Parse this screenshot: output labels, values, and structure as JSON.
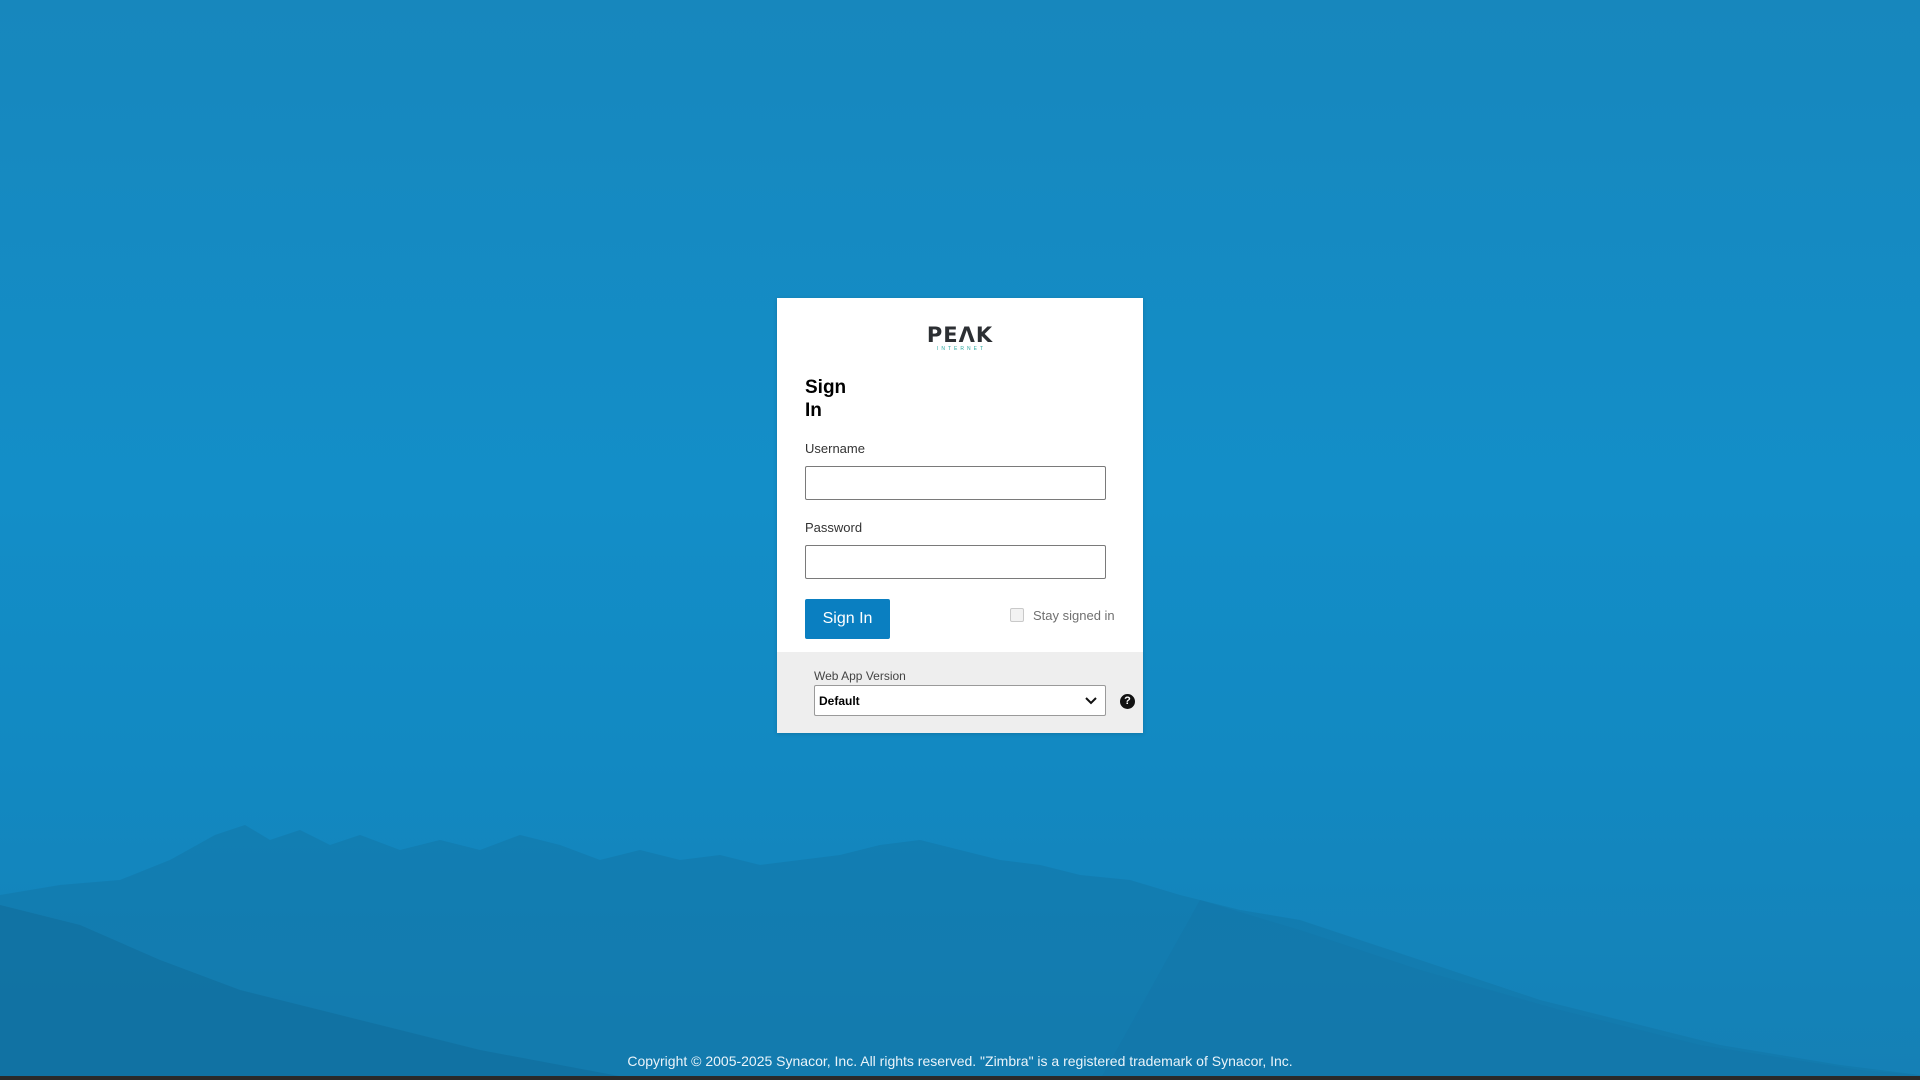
{
  "logo": {
    "word": "PEΛK",
    "sub": "INTERNET"
  },
  "login": {
    "title": "Sign In",
    "username_label": "Username",
    "username_value": "",
    "password_label": "Password",
    "password_value": "",
    "signin_label": "Sign In",
    "stay_signed_in_label": "Stay signed in",
    "stay_signed_in_checked": false
  },
  "version": {
    "label": "Web App Version",
    "selected": "Default",
    "help_glyph": "?"
  },
  "footer": {
    "copyright": "Copyright © 2005-2025 Synacor, Inc. All rights reserved. \"Zimbra\" is a registered trademark of Synacor, Inc."
  },
  "colors": {
    "background": "#138ec8",
    "button": "#0a7fc1",
    "panel": "#eeeeee"
  }
}
